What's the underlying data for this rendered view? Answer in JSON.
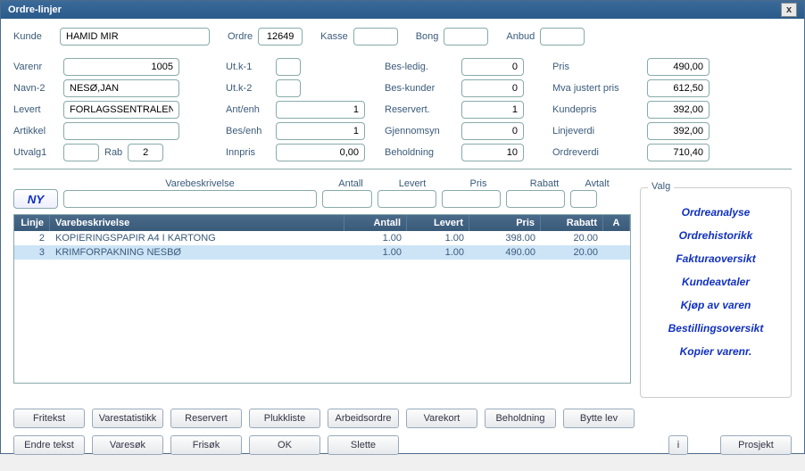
{
  "title": "Ordre-linjer",
  "top": {
    "kunde_label": "Kunde",
    "kunde": "HAMID MIR",
    "ordre_label": "Ordre",
    "ordre": "12649",
    "kasse_label": "Kasse",
    "kasse": "",
    "bong_label": "Bong",
    "bong": "",
    "anbud_label": "Anbud",
    "anbud": ""
  },
  "left": {
    "varenr_label": "Varenr",
    "varenr": "1005",
    "navn2_label": "Navn-2",
    "navn2": "NESØ,JAN",
    "levert_label": "Levert",
    "levert": "FORLAGSSENTRALEN AS",
    "artikkel_label": "Artikkel",
    "artikkel": "",
    "utvalg1_label": "Utvalg1",
    "utvalg1": "",
    "rab_label": "Rab",
    "rab": "2"
  },
  "mid": {
    "utk1_label": "Ut.k-1",
    "utk1": "",
    "utk2_label": "Ut.k-2",
    "utk2": "",
    "antenh_label": "Ant/enh",
    "antenh": "1",
    "besenh_label": "Bes/enh",
    "besenh": "1",
    "innpris_label": "Innpris",
    "innpris": "0,00"
  },
  "right1": {
    "besledig_label": "Bes-ledig.",
    "besledig": "0",
    "beskunder_label": "Bes-kunder",
    "beskunder": "0",
    "reservert_label": "Reservert.",
    "reservert": "1",
    "gjennomsyn_label": "Gjennomsyn",
    "gjennomsyn": "0",
    "beholdning_label": "Beholdning",
    "beholdning": "10"
  },
  "right2": {
    "pris_label": "Pris",
    "pris": "490,00",
    "mva_label": "Mva justert pris",
    "mva": "612,50",
    "kundepris_label": "Kundepris",
    "kundepris": "392,00",
    "linjeverdi_label": "Linjeverdi",
    "linjeverdi": "392,00",
    "ordreverdi_label": "Ordreverdi",
    "ordreverdi": "710,40"
  },
  "cols": {
    "varebeskrivelse": "Varebeskrivelse",
    "antall": "Antall",
    "levert": "Levert",
    "pris": "Pris",
    "rabatt": "Rabatt",
    "avtalt": "Avtalt"
  },
  "ny_label": "NY",
  "table": {
    "headers": {
      "linje": "Linje",
      "vare": "Varebeskrivelse",
      "antall": "Antall",
      "levert": "Levert",
      "pris": "Pris",
      "rabatt": "Rabatt",
      "a": "A"
    },
    "rows": [
      {
        "linje": "2",
        "vare": "KOPIERINGSPAPIR A4 I KARTONG",
        "antall": "1.00",
        "levert": "1.00",
        "pris": "398.00",
        "rabatt": "20.00",
        "a": ""
      },
      {
        "linje": "3",
        "vare": "KRIMFORPAKNING NESBØ",
        "antall": "1.00",
        "levert": "1.00",
        "pris": "490.00",
        "rabatt": "20.00",
        "a": ""
      }
    ]
  },
  "valg": {
    "title": "Valg",
    "links": [
      "Ordreanalyse",
      "Ordrehistorikk",
      "Fakturaoversikt",
      "Kundeavtaler",
      "Kjøp av varen",
      "Bestillingsoversikt",
      "Kopier varenr."
    ]
  },
  "buttons": {
    "row1": [
      "Fritekst",
      "Varestatistikk",
      "Reservert",
      "Plukkliste",
      "Arbeidsordre",
      "Varekort",
      "Beholdning",
      "Bytte lev"
    ],
    "row2_left": [
      "Endre tekst",
      "Varesøk",
      "Frisøk",
      "OK",
      "Slette"
    ],
    "i": "i",
    "prosjekt": "Prosjekt"
  }
}
